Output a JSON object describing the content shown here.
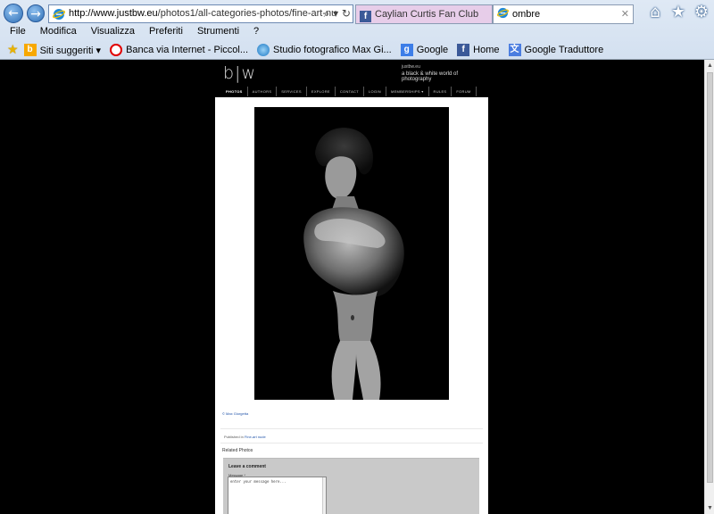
{
  "browser": {
    "nav": {
      "back": "←",
      "forward": "→"
    },
    "address": {
      "host": "http://www.justbw.eu",
      "path": "/photos1/all-categories-photos/fine-art-nud",
      "tools": "⌕ ▾ ↻"
    },
    "tabs": [
      {
        "label": "Caylian Curtis Fan Club",
        "icon": "facebook-icon"
      },
      {
        "label": "ombre",
        "icon": "ie-icon",
        "close": "✕"
      }
    ],
    "toolbar_icons": {
      "home": "⌂",
      "favorites": "★",
      "settings": "⚙"
    },
    "menu": [
      "File",
      "Modifica",
      "Visualizza",
      "Preferiti",
      "Strumenti",
      "?"
    ],
    "favorites": [
      {
        "label": "Siti suggeriti ▾",
        "icon": "bing-icon",
        "glyph": "b"
      },
      {
        "label": "Banca via Internet - Piccol...",
        "icon": "unicredit-icon",
        "glyph": ""
      },
      {
        "label": "Studio fotografico Max Gi...",
        "icon": "ie-icon",
        "glyph": ""
      },
      {
        "label": "Google",
        "icon": "google-icon",
        "glyph": "g"
      },
      {
        "label": "Home",
        "icon": "facebook-icon",
        "glyph": "f"
      },
      {
        "label": "Google Traduttore",
        "icon": "google-translate-icon",
        "glyph": "文"
      }
    ]
  },
  "site": {
    "logo": "b|w",
    "tagline_top": "justbw.eu",
    "tagline": "a black & white world of photography",
    "nav": [
      "PHOTOS",
      "AUTHORS",
      "SERVICES",
      "EXPLORE",
      "CONTACT",
      "LOGIN",
      "MEMBERSHIPS ▾",
      "RULES",
      "FORUM"
    ]
  },
  "content": {
    "credit": "© Max Giorgetta",
    "published_prefix": "Published in",
    "published_category": "Fine-art nude",
    "related_title": "Related Photos",
    "comment": {
      "title": "Leave a comment",
      "label": "Message *",
      "placeholder": "enter your message here..."
    }
  },
  "colors": {
    "page_bg": "#000000",
    "content_bg": "#ffffff",
    "link": "#2255aa",
    "chrome_bg": "#d9e4f2"
  }
}
